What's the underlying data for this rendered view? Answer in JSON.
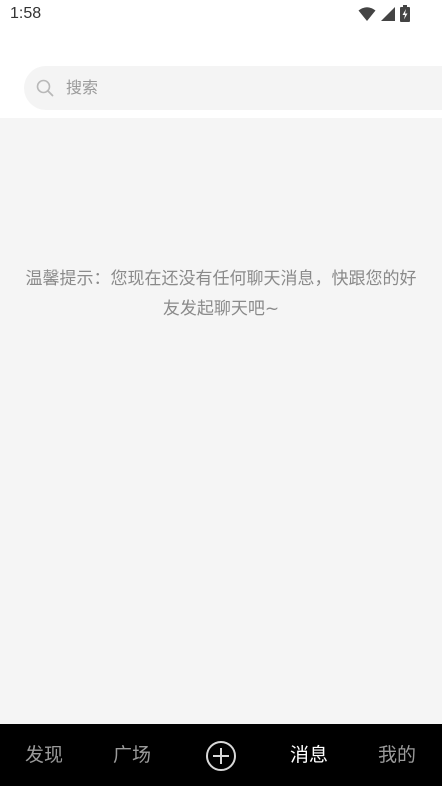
{
  "status_bar": {
    "time": "1:58",
    "icons": [
      "wifi-icon",
      "signal-icon",
      "battery-charging-icon"
    ]
  },
  "search": {
    "placeholder": "搜索",
    "icon": "search-icon"
  },
  "empty_state": {
    "message": "温馨提示：您现在还没有任何聊天消息，快跟您的好友发起聊天吧~"
  },
  "bottom_nav": {
    "items": [
      {
        "label": "发现",
        "active": false
      },
      {
        "label": "广场",
        "active": false
      },
      {
        "icon": "add-circle-icon"
      },
      {
        "label": "消息",
        "active": true
      },
      {
        "label": "我的",
        "active": false
      }
    ]
  },
  "colors": {
    "content_background": "#f5f5f5",
    "nav_background": "#000000",
    "nav_active": "#ffffff",
    "nav_inactive": "#9a9a9a",
    "hint_text": "#8a8a8a"
  }
}
